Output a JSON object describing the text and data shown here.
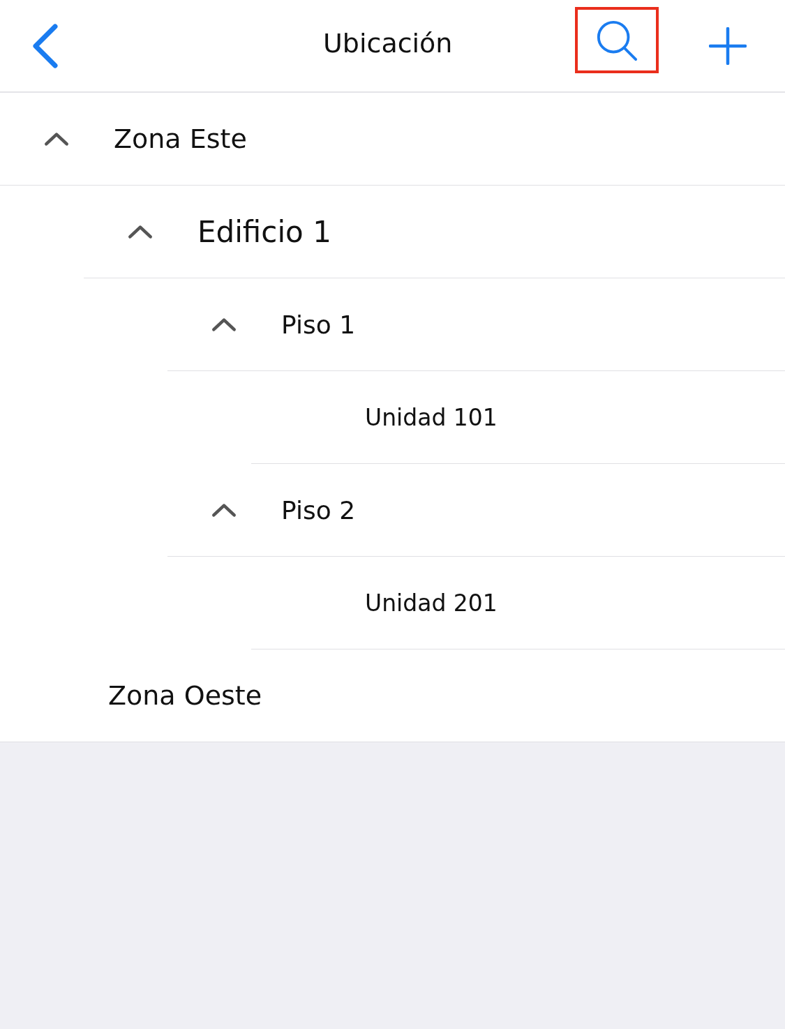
{
  "nav_bar": {
    "title": "Ubicación",
    "search_button": {
      "highlighted": true
    }
  },
  "tree": [
    {
      "label": "Zona Este",
      "expanded": true,
      "children": [
        {
          "label": "Edificio 1",
          "expanded": true,
          "children": [
            {
              "label": "Piso 1",
              "expanded": true,
              "children": [
                {
                  "label": "Unidad 101"
                }
              ]
            },
            {
              "label": "Piso 2",
              "expanded": true,
              "children": [
                {
                  "label": "Unidad 201"
                }
              ]
            }
          ]
        }
      ]
    },
    {
      "label": "Zona Oeste"
    }
  ]
}
